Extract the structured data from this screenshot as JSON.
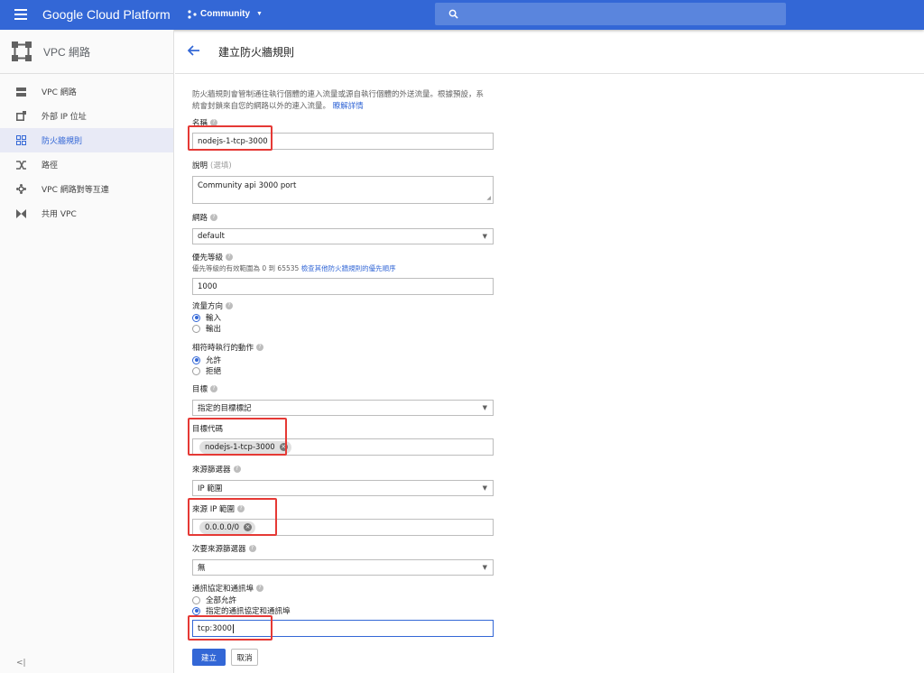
{
  "topbar": {
    "brand": "Google Cloud Platform",
    "project": "Community"
  },
  "sidebar": {
    "title": "VPC 網路",
    "items": [
      {
        "label": "VPC 網路",
        "icon": "vpc-network-icon"
      },
      {
        "label": "外部 IP 位址",
        "icon": "external-ip-icon"
      },
      {
        "label": "防火牆規則",
        "icon": "firewall-icon",
        "active": true
      },
      {
        "label": "路徑",
        "icon": "routes-icon"
      },
      {
        "label": "VPC 網路對等互連",
        "icon": "vpc-peering-icon"
      },
      {
        "label": "共用 VPC",
        "icon": "shared-vpc-icon"
      }
    ],
    "collapse": "<|"
  },
  "page": {
    "title": "建立防火牆規則",
    "intro": "防火牆規則會管制通往執行個體的連入流量或源自執行個體的外送流量。根據預設，系統會封鎖來自您的網路以外的連入流量。",
    "intro_link": "瞭解詳情"
  },
  "form": {
    "name_label": "名稱",
    "name_value": "nodejs-1-tcp-3000",
    "description_label": "說明",
    "description_optional": "(選填)",
    "description_value": "Community api 3000 port",
    "network_label": "網路",
    "network_value": "default",
    "priority_label": "優先等級",
    "priority_hint": "優先等級的有效範圍為 0 到 65535",
    "priority_link": "檢查其他防火牆規則的優先順序",
    "priority_value": "1000",
    "direction_label": "流量方向",
    "direction_options": [
      "輸入",
      "輸出"
    ],
    "direction_selected": "輸入",
    "action_label": "相符時執行的動作",
    "action_options": [
      "允許",
      "拒絕"
    ],
    "action_selected": "允許",
    "target_label": "目標",
    "target_value": "指定的目標標記",
    "target_tags_label": "目標代碼",
    "target_tag_chip": "nodejs-1-tcp-3000",
    "source_filter_label": "來源篩選器",
    "source_filter_value": "IP 範圍",
    "source_ip_label": "來源 IP 範圍",
    "source_ip_chip": "0.0.0.0/0",
    "second_source_label": "次要來源篩選器",
    "second_source_value": "無",
    "protocols_label": "通訊協定和通訊埠",
    "protocols_options": [
      "全部允許",
      "指定的通訊協定和通訊埠"
    ],
    "protocols_selected": "指定的通訊協定和通訊埠",
    "protocols_value": "tcp:3000",
    "create_button": "建立",
    "cancel_button": "取消"
  },
  "colors": {
    "brand_blue": "#3367d6",
    "highlight_red": "#e53935"
  }
}
